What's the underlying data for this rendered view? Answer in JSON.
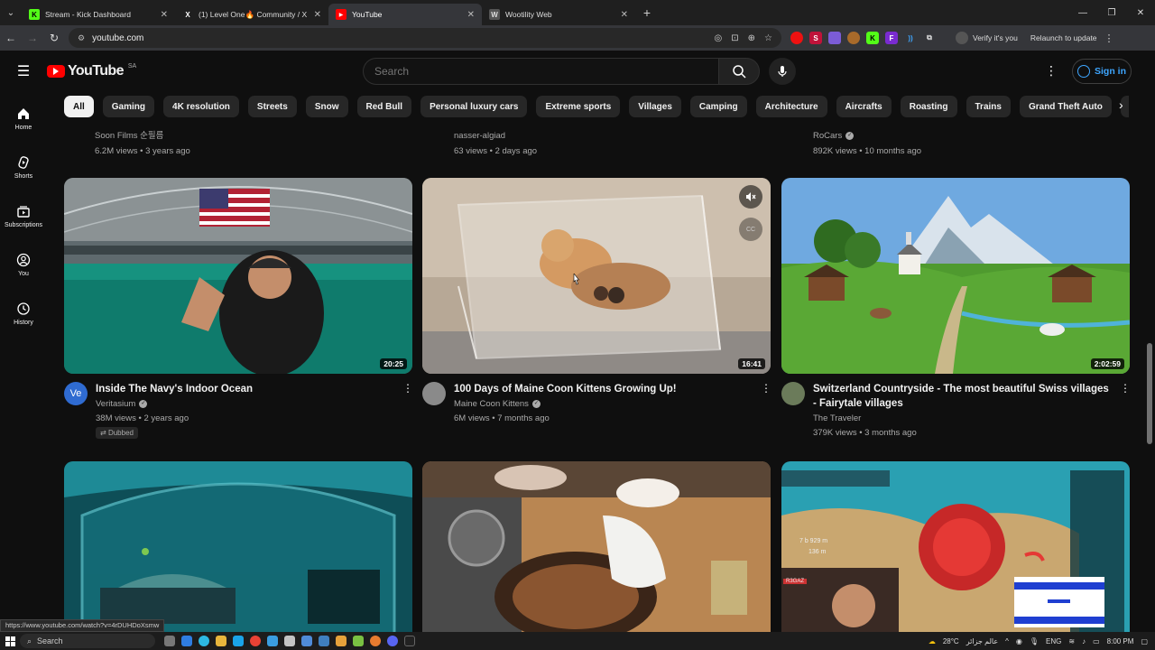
{
  "browser": {
    "tabs": [
      {
        "title": "Stream - Kick Dashboard",
        "favicon": "K",
        "color": "#53fc18",
        "active": false
      },
      {
        "title": "(1) Level One🔥 Community / X",
        "favicon": "X",
        "color": "#ffffff",
        "active": false
      },
      {
        "title": "YouTube",
        "favicon": "▶",
        "color": "#ff0000",
        "active": true
      },
      {
        "title": "Wootility Web",
        "favicon": "W",
        "color": "#9aa0a6",
        "active": false
      }
    ],
    "url": "youtube.com",
    "verify_label": "Verify it's you",
    "relaunch_label": "Relaunch to update",
    "status_url": "https://www.youtube.com/watch?v=4rDUHDoXsmw"
  },
  "youtube": {
    "logo_text": "YouTube",
    "country_code": "SA",
    "search_placeholder": "Search",
    "sign_in_label": "Sign in",
    "chips": [
      "All",
      "Gaming",
      "4K resolution",
      "Streets",
      "Snow",
      "Red Bull",
      "Personal luxury cars",
      "Extreme sports",
      "Villages",
      "Camping",
      "Architecture",
      "Aircrafts",
      "Roasting",
      "Trains",
      "Grand Theft Auto",
      "Grand Theft"
    ],
    "active_chip": "All",
    "sidebar": [
      {
        "label": "Home",
        "icon": "home-icon"
      },
      {
        "label": "Shorts",
        "icon": "shorts-icon"
      },
      {
        "label": "Subscriptions",
        "icon": "subscriptions-icon"
      },
      {
        "label": "You",
        "icon": "you-icon"
      },
      {
        "label": "History",
        "icon": "history-icon"
      }
    ],
    "previous_row": [
      {
        "channel": "Soon Films 순필름",
        "stats": "6.2M views • 3 years ago"
      },
      {
        "channel": "nasser-algiad",
        "stats": "63 views • 2 days ago"
      },
      {
        "channel": "RoCars",
        "stats": "892K views • 10 months ago"
      }
    ],
    "videos": [
      {
        "title": "Inside The Navy's Indoor Ocean",
        "channel": "Veritasium",
        "views": "38M views • 2 years ago",
        "duration": "20:25",
        "avatar": "Ve",
        "avatar_color": "#2f6bd1",
        "badge": "Dubbed"
      },
      {
        "title": "100 Days of Maine Coon Kittens Growing Up!",
        "channel": "Maine Coon Kittens",
        "views": "6M views • 7 months ago",
        "duration": "16:41",
        "avatar": "",
        "avatar_color": "#8a8a8a"
      },
      {
        "title": "Switzerland Countryside - The most beautiful Swiss villages - Fairytale villages",
        "channel": "The Traveler",
        "views": "379K views • 3 months ago",
        "duration": "2:02:59",
        "avatar": "",
        "avatar_color": "#6b7b5a"
      }
    ],
    "game_overlay": {
      "numbers": [
        "7 b 929 m",
        "136 m"
      ],
      "tag": "R3GAZ"
    }
  },
  "taskbar": {
    "search_label": "Search",
    "weather": "28°C",
    "weather_text": "عالم جزائر",
    "lang": "ENG",
    "time": "8:00 PM"
  }
}
